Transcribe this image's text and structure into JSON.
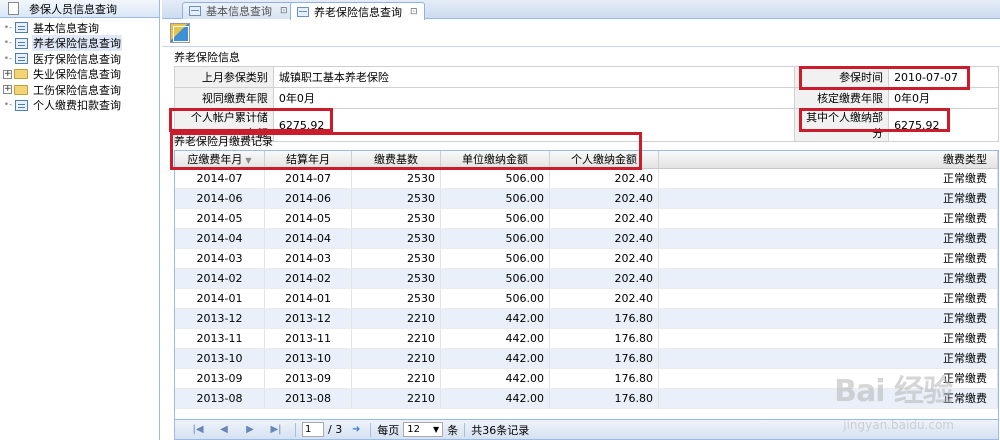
{
  "sidebar": {
    "title": "参保人员信息查询",
    "items": [
      {
        "label": "基本信息查询",
        "type": "doc",
        "selected": false
      },
      {
        "label": "养老保险信息查询",
        "type": "doc",
        "selected": true
      },
      {
        "label": "医疗保险信息查询",
        "type": "doc",
        "selected": false
      },
      {
        "label": "失业保险信息查询",
        "type": "folder",
        "selected": false
      },
      {
        "label": "工伤保险信息查询",
        "type": "folder",
        "selected": false
      },
      {
        "label": "个人缴费扣款查询",
        "type": "doc",
        "selected": false
      }
    ]
  },
  "tabs": [
    {
      "label": "基本信息查询",
      "active": false
    },
    {
      "label": "养老保险信息查询",
      "active": true
    }
  ],
  "info": {
    "section_title": "养老保险信息",
    "last_type_label": "上月参保类别",
    "last_type_value": "城镇职工基本养老保险",
    "join_time_label": "参保时间",
    "join_time_value": "2010-07-07",
    "deemed_years_label": "视同缴费年限",
    "deemed_years_value": "0年0月",
    "approved_years_label": "核定缴费年限",
    "approved_years_value": "0年0月",
    "account_total_label": "个人帐户累计储存额",
    "account_total_value": "6275.92",
    "personal_part_label": "其中个人缴纳部分",
    "personal_part_value": "6275.92"
  },
  "grid": {
    "section_title": "养老保险月缴费记录",
    "columns": [
      "应缴费年月",
      "结算年月",
      "缴费基数",
      "单位缴纳金额",
      "个人缴纳金额",
      "缴费类型"
    ],
    "rows": [
      [
        "2014-07",
        "2014-07",
        "2530",
        "506.00",
        "202.40",
        "正常缴费"
      ],
      [
        "2014-06",
        "2014-06",
        "2530",
        "506.00",
        "202.40",
        "正常缴费"
      ],
      [
        "2014-05",
        "2014-05",
        "2530",
        "506.00",
        "202.40",
        "正常缴费"
      ],
      [
        "2014-04",
        "2014-04",
        "2530",
        "506.00",
        "202.40",
        "正常缴费"
      ],
      [
        "2014-03",
        "2014-03",
        "2530",
        "506.00",
        "202.40",
        "正常缴费"
      ],
      [
        "2014-02",
        "2014-02",
        "2530",
        "506.00",
        "202.40",
        "正常缴费"
      ],
      [
        "2014-01",
        "2014-01",
        "2530",
        "506.00",
        "202.40",
        "正常缴费"
      ],
      [
        "2013-12",
        "2013-12",
        "2210",
        "442.00",
        "176.80",
        "正常缴费"
      ],
      [
        "2013-11",
        "2013-11",
        "2210",
        "442.00",
        "176.80",
        "正常缴费"
      ],
      [
        "2013-10",
        "2013-10",
        "2210",
        "442.00",
        "176.80",
        "正常缴费"
      ],
      [
        "2013-09",
        "2013-09",
        "2210",
        "442.00",
        "176.80",
        "正常缴费"
      ],
      [
        "2013-08",
        "2013-08",
        "2210",
        "442.00",
        "176.80",
        "正常缴费"
      ]
    ]
  },
  "pager": {
    "page_value": "1",
    "total_pages": "/ 3",
    "per_page_label": "每页",
    "per_page_value": "12",
    "unit_label": "条",
    "total_label": "共36条记录"
  },
  "watermark": {
    "main": "Bai 经验",
    "sub": "jingyan.baidu.com"
  },
  "colors": {
    "highlight": "#cc1b2a",
    "alt_row": "#e9f0fa",
    "border": "#99bbe8"
  }
}
